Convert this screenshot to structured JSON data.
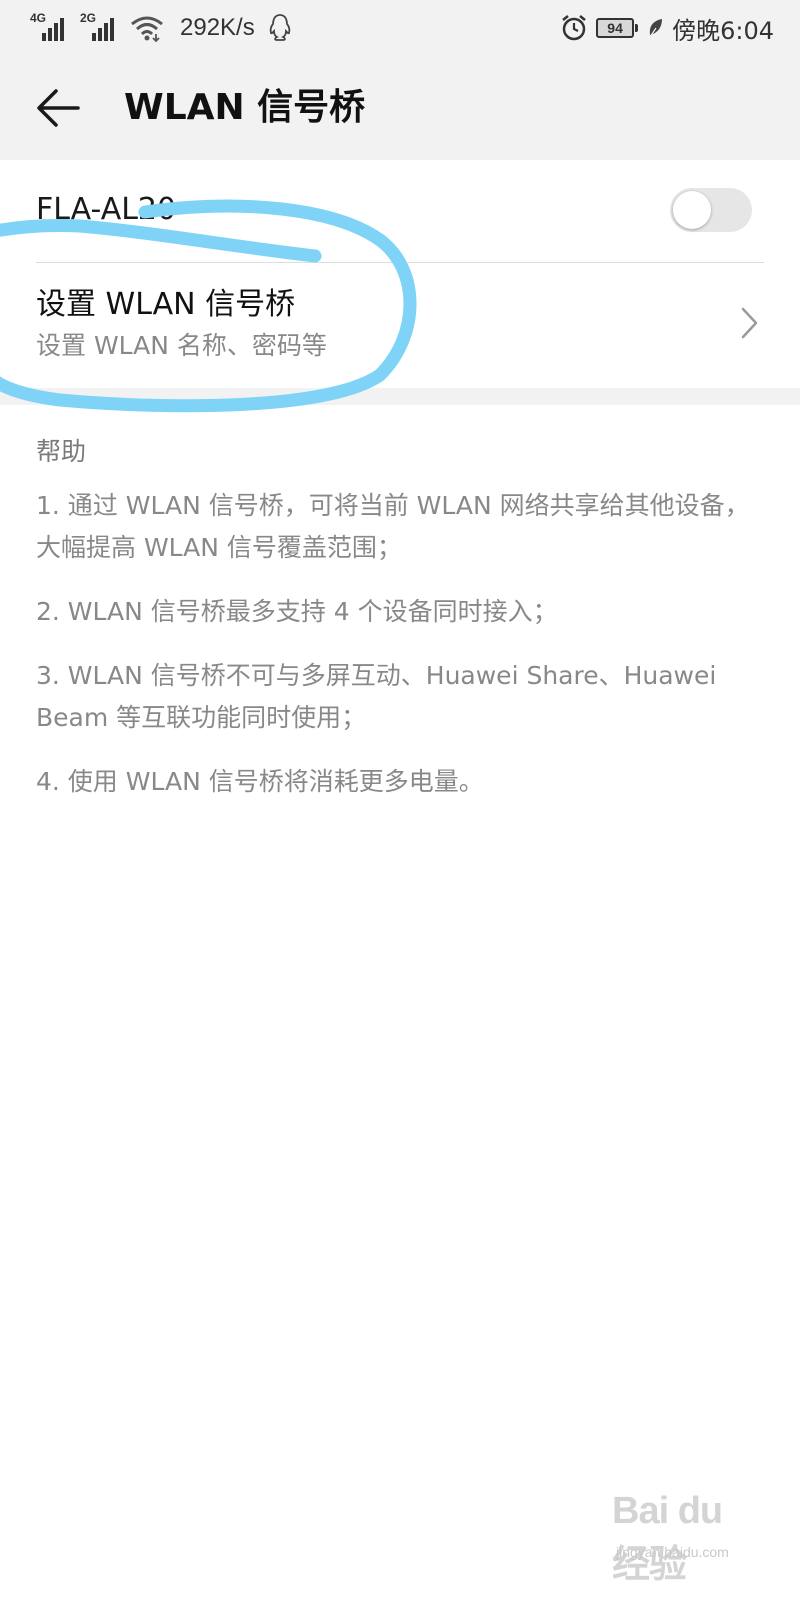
{
  "status_bar": {
    "network_1": "4G",
    "network_2": "2G",
    "speed": "292K/s",
    "battery_level": "94",
    "time": "傍晚6:04"
  },
  "app_bar": {
    "title": "WLAN 信号桥"
  },
  "hotspot": {
    "name": "FLA-AL20",
    "enabled": false
  },
  "setup": {
    "title": "设置 WLAN 信号桥",
    "subtitle": "设置 WLAN 名称、密码等"
  },
  "help": {
    "heading": "帮助",
    "items": [
      "1. 通过 WLAN 信号桥，可将当前 WLAN 网络共享给其他设备，大幅提高 WLAN 信号覆盖范围；",
      "2. WLAN 信号桥最多支持 4 个设备同时接入；",
      "3. WLAN 信号桥不可与多屏互动、Huawei Share、Huawei Beam 等互联功能同时使用；",
      "4. 使用 WLAN 信号桥将消耗更多电量。"
    ]
  },
  "watermark": {
    "logo": "Bai du 经验",
    "url": "jingyan.baidu.com"
  },
  "colors": {
    "annotation_stroke": "#7fd3f7",
    "toggle_off": "#e6e6e6",
    "secondary_text": "#888888"
  }
}
